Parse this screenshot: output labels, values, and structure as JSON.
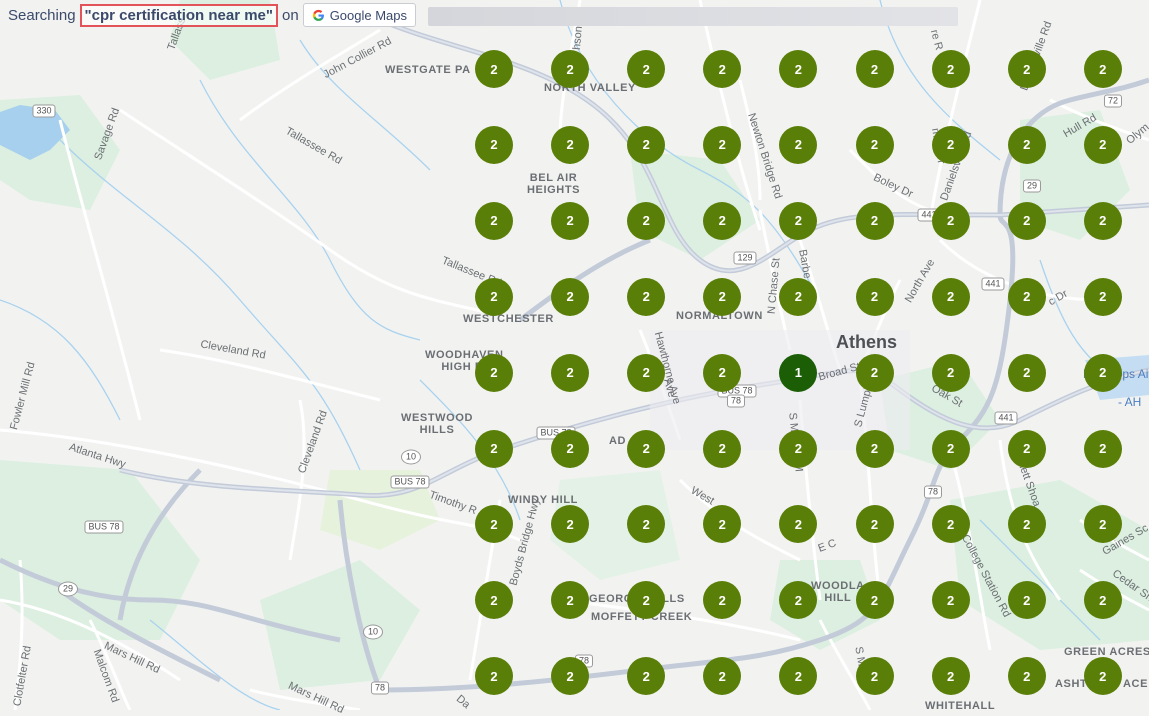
{
  "header": {
    "prefix": "Searching",
    "query": "\"cpr certification near me\"",
    "on_text": "on",
    "maps_button_label": "Google Maps"
  },
  "map": {
    "city_label": "Athens",
    "area_labels": [
      "WESTGATE PA",
      "NORTH VALLEY",
      "BEL AIR\nHEIGHTS",
      "WESTCHESTER",
      "NORMALTOWN",
      "WOODHAVEN\nHIGH RI",
      "WESTWOOD\nHILLS",
      "AD",
      "WINDY HILL",
      "GEORG",
      "HILLS",
      "MOFFETT CREEK",
      "WOODLA\nHILL",
      "GREEN ACRES",
      "ASHT",
      "ACE",
      "WHITEHALL"
    ],
    "road_labels": [
      "John Collier Rd",
      "Tallass",
      "Savage Rd",
      "Tallassee Rd",
      "Tallassee Rd",
      "Cleveland Rd",
      "Fowler Mill Rd",
      "Cleveland Rd",
      "Atlanta Hwy",
      "Timothy R",
      "Mars Hill Rd",
      "Malcom Rd",
      "Clotfelter Rd",
      "Mars Hill Rd",
      "Da",
      "Newton Bridge Rd",
      "N Chase St",
      "Barbe",
      "Boley Dr",
      "Danielsville Rd",
      "Danielsville Rd",
      "Hull Rd",
      "Olym",
      "North Ave",
      "c Dr",
      "Broad St",
      "Oak St",
      "S Lumpk",
      "S Milled",
      "Barnett Shoa",
      "College Station Rd",
      "Gaines Sc",
      "Cedar Shoal",
      "West",
      "E C",
      "Hawthorne Ave",
      "Boyds Bridge Hwy",
      "S Mill",
      "S M",
      "man Dr",
      "Ave",
      "hson",
      "re R"
    ],
    "airport_label": "Ben Epps Airport - AH",
    "airport_lines": [
      "Ben Epps Airpo",
      "- AH"
    ],
    "shields": [
      "330",
      "72",
      "29",
      "441",
      "441",
      "129",
      "BUS 78",
      "78",
      "10",
      "BUS 78",
      "BUS 78",
      "29",
      "10",
      "78",
      "BUS 78",
      "78",
      "441",
      "78"
    ]
  },
  "grid": {
    "rows": [
      [
        "2",
        "2",
        "2",
        "2",
        "2",
        "2",
        "2",
        "2",
        "2"
      ],
      [
        "2",
        "2",
        "2",
        "2",
        "2",
        "2",
        "2",
        "2",
        "2"
      ],
      [
        "2",
        "2",
        "2",
        "2",
        "2",
        "2",
        "2",
        "2",
        "2"
      ],
      [
        "2",
        "2",
        "2",
        "2",
        "2",
        "2",
        "2",
        "2",
        "2"
      ],
      [
        "2",
        "2",
        "2",
        "2",
        "1",
        "2",
        "2",
        "2",
        "2"
      ],
      [
        "2",
        "2",
        "2",
        "2",
        "2",
        "2",
        "2",
        "2",
        "2"
      ],
      [
        "2",
        "2",
        "2",
        "2",
        "2",
        "2",
        "2",
        "2",
        "2"
      ],
      [
        "2",
        "2",
        "2",
        "2",
        "2",
        "2",
        "2",
        "2",
        "2"
      ],
      [
        "2",
        "2",
        "2",
        "2",
        "2",
        "2",
        "2",
        "2",
        "2"
      ]
    ],
    "colors": {
      "rank_2": "#5a7f08",
      "rank_1": "#1b5e06"
    }
  }
}
